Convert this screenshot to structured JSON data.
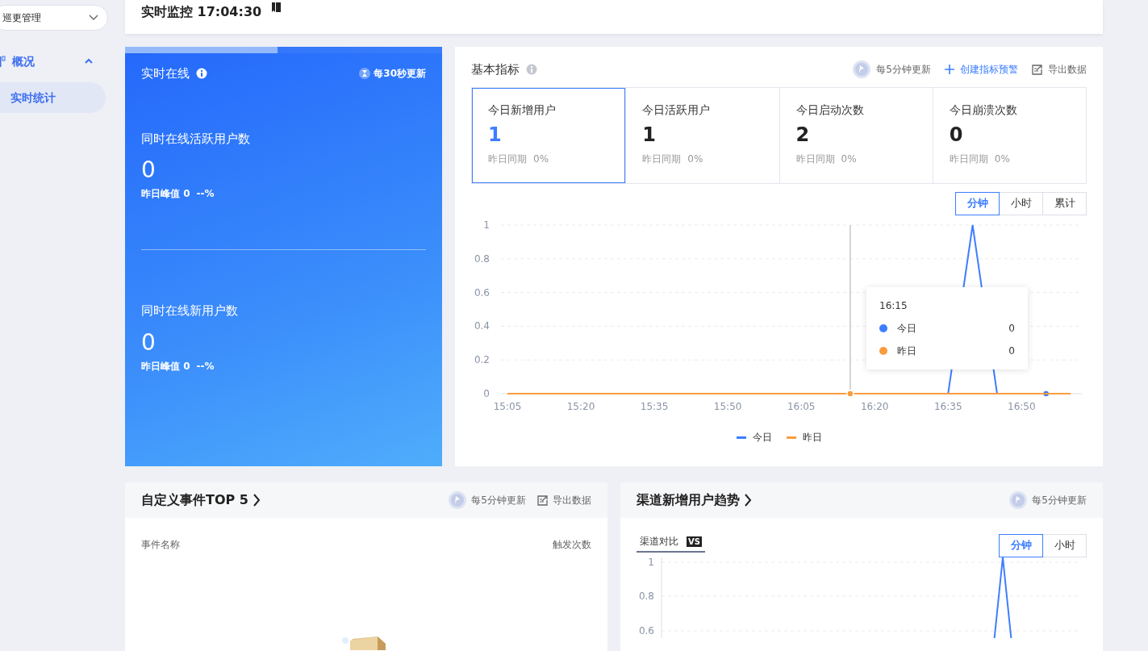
{
  "sidebar": {
    "dropdown": "巡更管理",
    "groups": [
      {
        "label": "概况",
        "expanded": true,
        "items": [
          {
            "label": "实时统计",
            "selected": true
          }
        ]
      }
    ]
  },
  "header": {
    "title": "实时监控 17:04:30"
  },
  "online": {
    "title": "实时在线",
    "refresh": "每30秒更新",
    "level": 0.48,
    "sections": [
      {
        "label": "同时在线活跃用户数",
        "value": "0",
        "peak": "昨日峰值 0",
        "change": "--%"
      },
      {
        "label": "同时在线新用户数",
        "value": "0",
        "peak": "昨日峰值 0",
        "change": "--%"
      }
    ]
  },
  "metrics": {
    "title": "基本指标",
    "refresh": "每5分钟更新",
    "create_alert": "创建指标预警",
    "export": "导出数据",
    "tiles": [
      {
        "label": "今日新增用户",
        "value": "1",
        "compare": "昨日同期",
        "change": "0%",
        "selected": true
      },
      {
        "label": "今日活跃用户",
        "value": "1",
        "compare": "昨日同期",
        "change": "0%",
        "selected": false
      },
      {
        "label": "今日启动次数",
        "value": "2",
        "compare": "昨日同期",
        "change": "0%",
        "selected": false
      },
      {
        "label": "今日崩溃次数",
        "value": "0",
        "compare": "昨日同期",
        "change": "0%",
        "selected": false
      }
    ],
    "granularity": [
      {
        "label": "分钟",
        "selected": true
      },
      {
        "label": "小时",
        "selected": false
      },
      {
        "label": "累计",
        "selected": false
      }
    ],
    "chart_data": {
      "type": "line",
      "grid": true,
      "categories": [
        "15:05",
        null,
        null,
        "15:20",
        null,
        null,
        "15:35",
        null,
        null,
        "15:50",
        null,
        null,
        "16:05",
        null,
        null,
        "16:20",
        null,
        null,
        "16:35",
        null,
        null,
        "16:50",
        null,
        null
      ],
      "ylim": [
        0,
        1
      ],
      "yticks": [
        0,
        0.2,
        0.4,
        0.6,
        0.8,
        1
      ],
      "series": [
        {
          "name": "今日",
          "color": "#3d7eff",
          "values": [
            null,
            null,
            null,
            null,
            null,
            null,
            null,
            null,
            null,
            null,
            null,
            null,
            null,
            null,
            null,
            null,
            null,
            null,
            0,
            1,
            0,
            null,
            0,
            null
          ]
        },
        {
          "name": "昨日",
          "color": "#fa9c3e",
          "values": [
            0,
            0,
            0,
            0,
            0,
            0,
            0,
            0,
            0,
            0,
            0,
            0,
            0,
            0,
            0,
            0,
            0,
            0,
            0,
            0,
            0,
            0,
            0,
            0
          ]
        }
      ]
    },
    "tooltip": {
      "title": "16:15",
      "rows": [
        {
          "name": "今日",
          "color": "#3d7eff",
          "value": "0"
        },
        {
          "name": "昨日",
          "color": "#fa9c3e",
          "value": "0"
        }
      ]
    }
  },
  "events": {
    "title": "自定义事件TOP 5",
    "refresh": "每5分钟更新",
    "export": "导出数据",
    "columns": [
      "事件名称",
      "触发次数"
    ]
  },
  "channels": {
    "title": "渠道新增用户趋势",
    "refresh": "每5分钟更新",
    "compare_tab": "渠道对比",
    "vs": "VS",
    "granularity": [
      {
        "label": "分钟",
        "selected": true
      },
      {
        "label": "小时",
        "selected": false
      }
    ],
    "chart": {
      "y_labels": [
        "1",
        "0.8",
        "0.6"
      ]
    }
  }
}
